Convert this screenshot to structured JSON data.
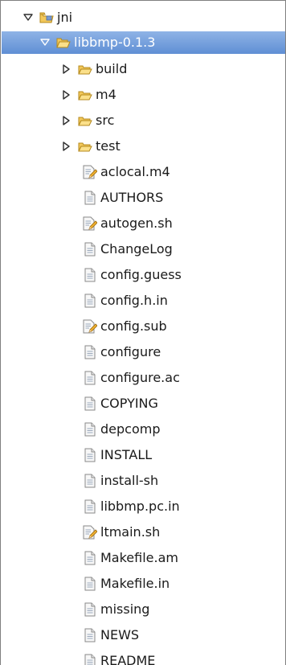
{
  "tree": {
    "root": {
      "label": "jni",
      "expanded": true,
      "icon": "project-folder-icon"
    },
    "project": {
      "label": "libbmp-0.1.3",
      "expanded": true,
      "selected": true,
      "icon": "open-folder-icon"
    },
    "folders": [
      {
        "label": "build",
        "icon": "folder-icon"
      },
      {
        "label": "m4",
        "icon": "folder-icon"
      },
      {
        "label": "src",
        "icon": "folder-icon"
      },
      {
        "label": "test",
        "icon": "folder-icon"
      }
    ],
    "files": [
      {
        "label": "aclocal.m4",
        "icon": "script-file-icon"
      },
      {
        "label": "AUTHORS",
        "icon": "text-file-icon"
      },
      {
        "label": "autogen.sh",
        "icon": "script-file-icon"
      },
      {
        "label": "ChangeLog",
        "icon": "text-file-icon"
      },
      {
        "label": "config.guess",
        "icon": "text-file-icon"
      },
      {
        "label": "config.h.in",
        "icon": "text-file-icon"
      },
      {
        "label": "config.sub",
        "icon": "script-file-icon"
      },
      {
        "label": "configure",
        "icon": "text-file-icon"
      },
      {
        "label": "configure.ac",
        "icon": "text-file-icon"
      },
      {
        "label": "COPYING",
        "icon": "text-file-icon"
      },
      {
        "label": "depcomp",
        "icon": "text-file-icon"
      },
      {
        "label": "INSTALL",
        "icon": "text-file-icon"
      },
      {
        "label": "install-sh",
        "icon": "text-file-icon"
      },
      {
        "label": "libbmp.pc.in",
        "icon": "text-file-icon"
      },
      {
        "label": "ltmain.sh",
        "icon": "script-file-icon"
      },
      {
        "label": "Makefile.am",
        "icon": "text-file-icon"
      },
      {
        "label": "Makefile.in",
        "icon": "text-file-icon"
      },
      {
        "label": "missing",
        "icon": "text-file-icon"
      },
      {
        "label": "NEWS",
        "icon": "text-file-icon"
      },
      {
        "label": "README",
        "icon": "text-file-icon"
      }
    ]
  },
  "colors": {
    "selection_top": "#8fb3e6",
    "selection_bottom": "#5f8fd4",
    "folder": "#f3c85a",
    "folder_stroke": "#b58a1d",
    "twisty": "#2d2d2d"
  }
}
